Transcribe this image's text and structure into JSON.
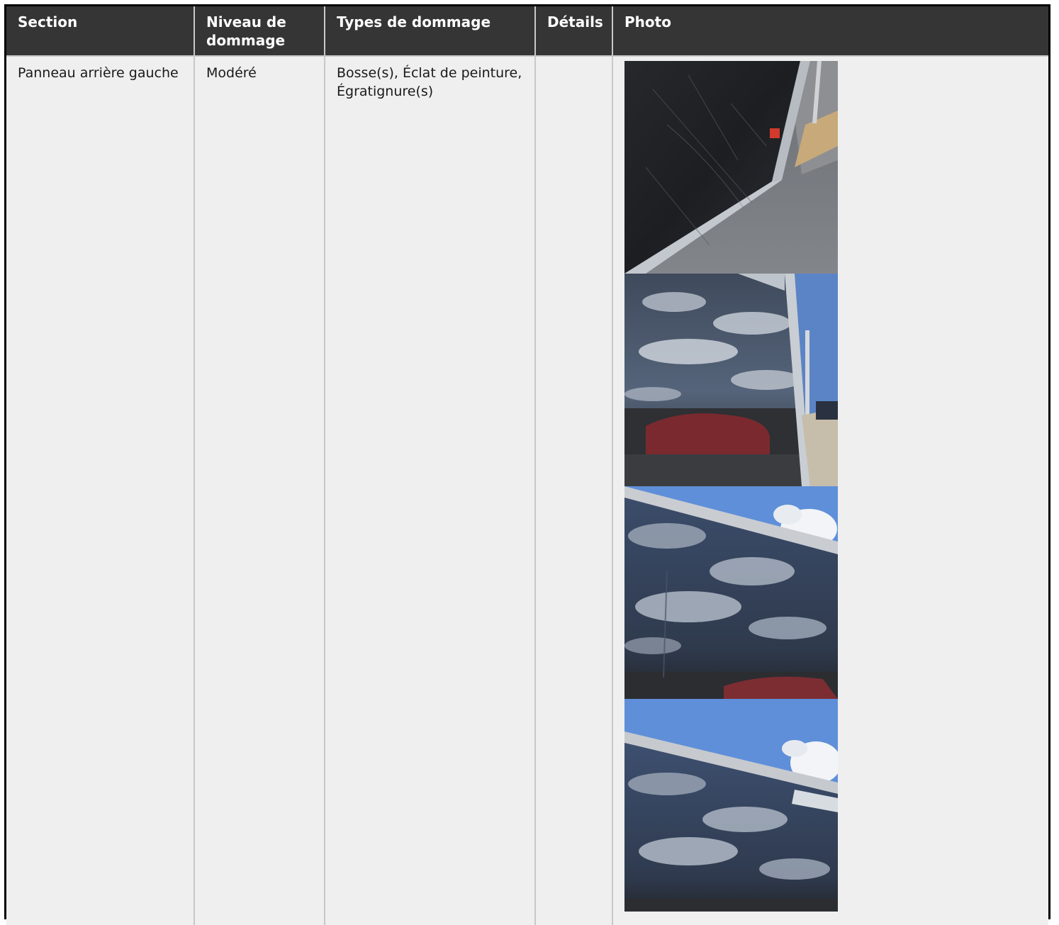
{
  "table": {
    "headers": {
      "section": "Section",
      "niveau": "Niveau de dommage",
      "types": "Types de dommage",
      "details": "Détails",
      "photo": "Photo"
    },
    "rows": [
      {
        "section": "Panneau arrière gauche",
        "niveau": "Modéré",
        "types": "Bosse(s), Éclat de peinture, Égratignure(s)",
        "details": "",
        "photos": [
          {
            "description": "Black trailer panel with scratches, aluminum frame edge and asphalt"
          },
          {
            "description": "Glossy black panel reflecting clouds and red car, partial logo at top"
          },
          {
            "description": "Black panel reflecting blue sky and clouds under aluminum rail"
          },
          {
            "description": "Black panel under aluminum rail with white logo reflecting clouds"
          }
        ]
      }
    ]
  },
  "colors": {
    "header_bg": "#353535",
    "header_text": "#ffffff",
    "row_bg": "#efefef",
    "border": "#c8c8c8",
    "frame": "#000000"
  }
}
